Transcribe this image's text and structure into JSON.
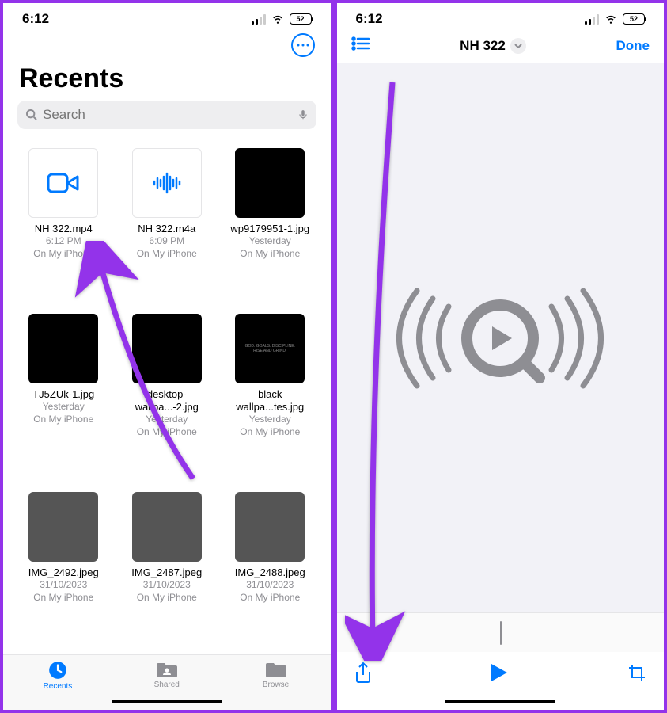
{
  "status": {
    "time": "6:12",
    "battery": "52"
  },
  "left": {
    "title": "Recents",
    "search_placeholder": "Search",
    "files": [
      {
        "name": "NH 322.mp4",
        "date": "6:12 PM",
        "loc": "On My iPhone",
        "type": "video"
      },
      {
        "name": "NH 322.m4a",
        "date": "6:09 PM",
        "loc": "On My iPhone",
        "type": "audio"
      },
      {
        "name": "wp9179951-1.jpg",
        "date": "Yesterday",
        "loc": "On My iPhone",
        "type": "black"
      },
      {
        "name": "TJ5ZUk-1.jpg",
        "date": "Yesterday",
        "loc": "On My iPhone",
        "type": "black"
      },
      {
        "name": "desktop-wallpa...-2.jpg",
        "date": "Yesterday",
        "loc": "On My iPhone",
        "type": "black"
      },
      {
        "name": "black wallpa...tes.jpg",
        "date": "Yesterday",
        "loc": "On My iPhone",
        "type": "black"
      },
      {
        "name": "IMG_2492.jpeg",
        "date": "31/10/2023",
        "loc": "On My iPhone",
        "type": "photo1"
      },
      {
        "name": "IMG_2487.jpeg",
        "date": "31/10/2023",
        "loc": "On My iPhone",
        "type": "photo2"
      },
      {
        "name": "IMG_2488.jpeg",
        "date": "31/10/2023",
        "loc": "On My iPhone",
        "type": "photo3"
      }
    ],
    "tabs": {
      "recents": "Recents",
      "shared": "Shared",
      "browse": "Browse"
    }
  },
  "right": {
    "title": "NH 322",
    "done": "Done"
  },
  "black_texts": [
    "",
    "",
    "",
    "",
    "GOD. GOALS. DISCIPLINE. RISE AND GRIND."
  ]
}
